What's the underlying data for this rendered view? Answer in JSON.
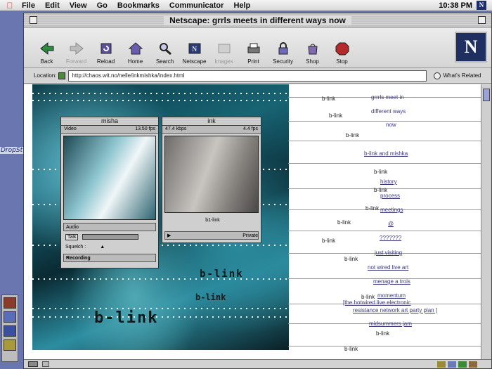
{
  "menubar": {
    "items": [
      "File",
      "Edit",
      "View",
      "Go",
      "Bookmarks",
      "Communicator",
      "Help"
    ],
    "clock": "10:38 PM"
  },
  "window": {
    "title": "Netscape: grrls meets in different ways now"
  },
  "toolbar": {
    "buttons": [
      {
        "label": "Back",
        "icon": "back-arrow-icon"
      },
      {
        "label": "Forward",
        "icon": "forward-arrow-icon"
      },
      {
        "label": "Reload",
        "icon": "reload-icon"
      },
      {
        "label": "Home",
        "icon": "home-icon"
      },
      {
        "label": "Search",
        "icon": "search-icon"
      },
      {
        "label": "Netscape",
        "icon": "netscape-icon"
      },
      {
        "label": "Images",
        "icon": "images-icon"
      },
      {
        "label": "Print",
        "icon": "print-icon"
      },
      {
        "label": "Security",
        "icon": "security-lock-icon"
      },
      {
        "label": "Shop",
        "icon": "shop-icon"
      },
      {
        "label": "Stop",
        "icon": "stop-icon"
      }
    ],
    "logo": "N"
  },
  "location": {
    "label": "Location:",
    "url": "http://chaos.wit.no/nelle/inkmishka/index.html",
    "whats_related": "What's Related"
  },
  "desktop": {
    "label": "DropSt"
  },
  "cuseeme": {
    "misha": {
      "title": "misha",
      "video_label": "Video",
      "fps": "13.50 fps",
      "audio_label": "Audio",
      "talk": "Talk",
      "squelch": "Squelch :",
      "recording": "Recording"
    },
    "ink": {
      "title": "ink",
      "kbps": "47.4 kbps",
      "fps": "4.4 fps",
      "name": "b1-link",
      "private": "Private"
    }
  },
  "page": {
    "blink_text": "b-link",
    "big_blink_1": "b-link",
    "big_blink_2": "b-link",
    "blink_overlay": "b-link",
    "nav": [
      "grrrls meet in",
      "different ways",
      "now",
      "b-link and mishka",
      "history",
      "process",
      "meetings",
      "@",
      "???????",
      "just visiting",
      "not wired live art",
      "menage a trois",
      "momentum",
      "[the hotwired live electronic",
      "resistance network art party plan ]",
      "midsummers jam"
    ]
  }
}
